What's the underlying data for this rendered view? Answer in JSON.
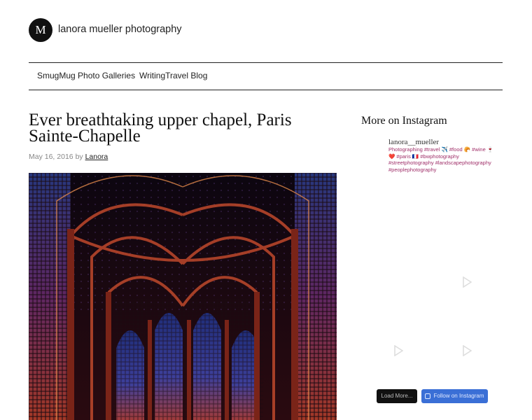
{
  "site": {
    "logo_letter": "M",
    "title": "lanora mueller photography"
  },
  "nav": {
    "items": [
      "SmugMug Photo Galleries",
      "WritingTravel Blog"
    ]
  },
  "post": {
    "title": "Ever breathtaking upper chapel, Paris Sainte-Chapelle",
    "date": "May 16, 2016",
    "by": "by",
    "author": "Lanora"
  },
  "sidebar": {
    "widget_title": "More on Instagram",
    "instagram": {
      "username": "lanora__mueller",
      "bio": "Photographing #travel ✈️ #food 🥐 #wine 🍷 ❤️ #paris 🇫🇷 #bwphotography #streetphotography #landscapephotography #peoplephotography",
      "load_more_label": "Load More...",
      "follow_label": "Follow on Instagram"
    }
  }
}
